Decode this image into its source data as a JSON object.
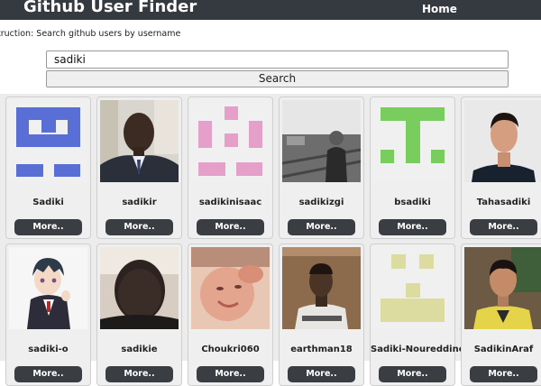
{
  "header": {
    "title": "Github User Finder",
    "nav_home": "Home"
  },
  "instruction": "truction: Search github users by username",
  "search": {
    "value": "sadiki",
    "button_label": "Search"
  },
  "more_label": "More..",
  "users": [
    {
      "login": "Sadiki",
      "avatar": "identicon-blue-icon"
    },
    {
      "login": "sadikir",
      "avatar": "man-suit-photo"
    },
    {
      "login": "sadikinisaac",
      "avatar": "identicon-pink-icon"
    },
    {
      "login": "sadikizgi",
      "avatar": "street-photo"
    },
    {
      "login": "bsadiki",
      "avatar": "identicon-green-icon"
    },
    {
      "login": "Tahasadiki",
      "avatar": "man-portrait-photo"
    },
    {
      "login": "sadiki-o",
      "avatar": "anime-character-image"
    },
    {
      "login": "sadikie",
      "avatar": "man-face-photo"
    },
    {
      "login": "Choukri060",
      "avatar": "baby-photo"
    },
    {
      "login": "earthman18",
      "avatar": "young-man-photo"
    },
    {
      "login": "Sadiki-Noureddine",
      "avatar": "identicon-olive-icon"
    },
    {
      "login": "SadikinAraf",
      "avatar": "boy-photo"
    }
  ],
  "colors": {
    "topbar": "#343a40",
    "more_button": "#3a3d42",
    "identicon_blue": "#5a6fd6",
    "identicon_pink": "#e5a0c9",
    "identicon_green": "#79cc5e",
    "identicon_olive": "#dcdca0"
  }
}
